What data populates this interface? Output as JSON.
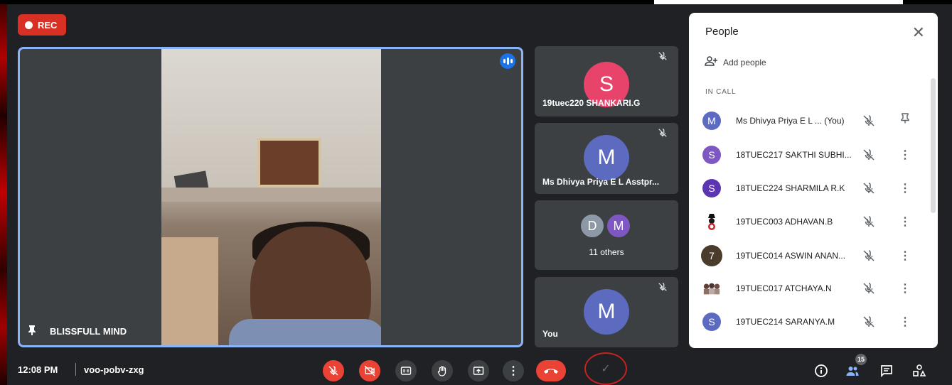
{
  "recording": {
    "label": "REC"
  },
  "main_tile": {
    "name": "BLISSFULL MIND"
  },
  "side_tiles": [
    {
      "initial": "S",
      "name": "19tuec220 SHANKARI.G",
      "color": "#e8436b"
    },
    {
      "initial": "M",
      "name": "Ms Dhivya Priya E L Asstpr...",
      "color": "#5c6bc0"
    },
    {
      "initials": [
        "D",
        "M"
      ],
      "colors": [
        "#8d99a6",
        "#7e57c2"
      ],
      "label": "11 others"
    },
    {
      "initial": "M",
      "name": "You",
      "color": "#5c6bc0"
    }
  ],
  "people_panel": {
    "title": "People",
    "add_label": "Add people",
    "section_label": "IN CALL",
    "participants": [
      {
        "initial": "M",
        "name": "Ms Dhivya Priya E L ...  (You)",
        "color": "#5c6bc0",
        "action": "pin-icon"
      },
      {
        "initial": "S",
        "name": "18TUEC217 SAKTHI SUBHI...",
        "color": "#7e57c2",
        "action": "more-icon"
      },
      {
        "initial": "S",
        "name": "18TUEC224 SHARMILA R.K",
        "color": "#5e35b1",
        "action": "more-icon"
      },
      {
        "initial": "",
        "name": "19TUEC003 ADHAVAN.B",
        "color": "#ffffff",
        "action": "more-icon"
      },
      {
        "initial": "7",
        "name": "19TUEC014 ASWIN ANAN...",
        "color": "#4a3b2a",
        "action": "more-icon"
      },
      {
        "initial": "",
        "name": "19TUEC017 ATCHAYA.N",
        "color": "#ffffff",
        "action": "more-icon"
      },
      {
        "initial": "S",
        "name": "19TUEC214 SARANYA.M",
        "color": "#5c6bc0",
        "action": "more-icon"
      }
    ]
  },
  "bottom_bar": {
    "time": "12:08 PM",
    "meeting_code": "voo-pobv-zxg",
    "people_count": "15"
  }
}
